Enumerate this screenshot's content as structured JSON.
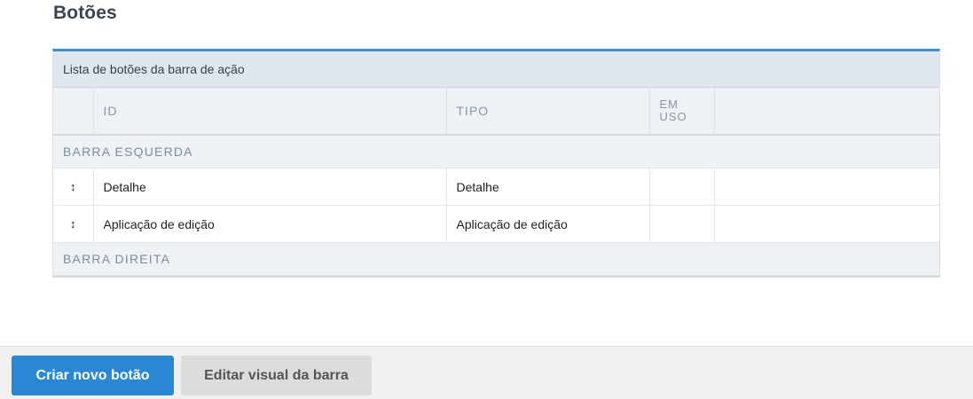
{
  "page": {
    "title": "Botões"
  },
  "panel": {
    "caption": "Lista de botões da barra de ação",
    "columns": {
      "id": "ID",
      "type": "TIPO",
      "in_use_line1": "EM",
      "in_use_line2": "USO"
    },
    "groups": [
      {
        "label": "BARRA ESQUERDA",
        "rows": [
          {
            "handle_icon": "↕",
            "id": "Detalhe",
            "type": "Detalhe",
            "in_use": ""
          },
          {
            "handle_icon": "↕",
            "id": "Aplicação de edição",
            "type": "Aplicação de edição",
            "in_use": ""
          }
        ]
      },
      {
        "label": "BARRA DIREITA",
        "rows": []
      }
    ]
  },
  "footer": {
    "create_button": "Criar novo botão",
    "edit_visual_button": "Editar visual da barra"
  },
  "colors": {
    "accent": "#2a87d4",
    "panel_top_border": "#3a8fd6",
    "header_bg": "#eef2f6"
  }
}
